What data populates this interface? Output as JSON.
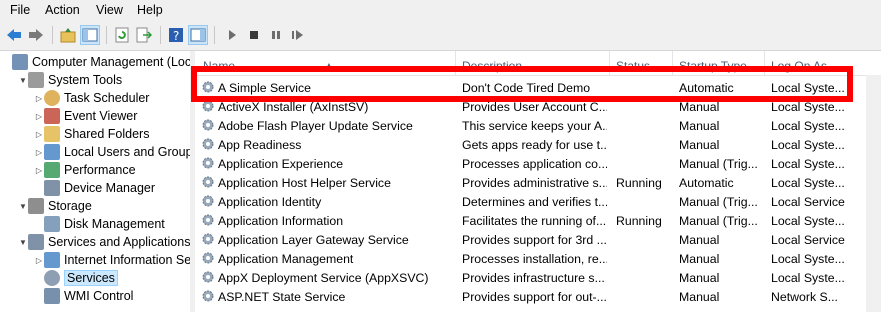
{
  "menu": [
    "File",
    "Action",
    "View",
    "Help"
  ],
  "tree": [
    {
      "label": "Computer Management (Local",
      "indent": 0,
      "arrow": "",
      "icon": "computer-icon"
    },
    {
      "label": "System Tools",
      "indent": 1,
      "arrow": "▼",
      "icon": "tools-icon"
    },
    {
      "label": "Task Scheduler",
      "indent": 2,
      "arrow": "▷",
      "icon": "clock-icon"
    },
    {
      "label": "Event Viewer",
      "indent": 2,
      "arrow": "▷",
      "icon": "event-viewer-icon"
    },
    {
      "label": "Shared Folders",
      "indent": 2,
      "arrow": "▷",
      "icon": "shared-folder-icon"
    },
    {
      "label": "Local Users and Groups",
      "indent": 2,
      "arrow": "▷",
      "icon": "users-icon"
    },
    {
      "label": "Performance",
      "indent": 2,
      "arrow": "▷",
      "icon": "performance-icon"
    },
    {
      "label": "Device Manager",
      "indent": 2,
      "arrow": "",
      "icon": "device-manager-icon"
    },
    {
      "label": "Storage",
      "indent": 1,
      "arrow": "▼",
      "icon": "storage-icon"
    },
    {
      "label": "Disk Management",
      "indent": 2,
      "arrow": "",
      "icon": "disk-icon"
    },
    {
      "label": "Services and Applications",
      "indent": 1,
      "arrow": "▼",
      "icon": "services-apps-icon"
    },
    {
      "label": "Internet Information Ser",
      "indent": 2,
      "arrow": "▷",
      "icon": "iis-icon"
    },
    {
      "label": "Services",
      "indent": 2,
      "arrow": "",
      "icon": "services-icon",
      "selected": true
    },
    {
      "label": "WMI Control",
      "indent": 2,
      "arrow": "",
      "icon": "wmi-icon"
    }
  ],
  "columns": {
    "name": "Name",
    "description": "Description",
    "status": "Status",
    "startup": "Startup Type",
    "logon": "Log On As"
  },
  "rows": [
    {
      "name": "A Simple Service",
      "description": "Don't Code Tired Demo",
      "status": "",
      "startup": "Automatic",
      "logon": "Local Syste..."
    },
    {
      "name": "ActiveX Installer (AxInstSV)",
      "description": "Provides User Account C...",
      "status": "",
      "startup": "Manual",
      "logon": "Local Syste..."
    },
    {
      "name": "Adobe Flash Player Update Service",
      "description": "This service keeps your A...",
      "status": "",
      "startup": "Manual",
      "logon": "Local Syste..."
    },
    {
      "name": "App Readiness",
      "description": "Gets apps ready for use t...",
      "status": "",
      "startup": "Manual",
      "logon": "Local Syste..."
    },
    {
      "name": "Application Experience",
      "description": "Processes application co...",
      "status": "",
      "startup": "Manual (Trig...",
      "logon": "Local Syste..."
    },
    {
      "name": "Application Host Helper Service",
      "description": "Provides administrative s...",
      "status": "Running",
      "startup": "Automatic",
      "logon": "Local Syste..."
    },
    {
      "name": "Application Identity",
      "description": "Determines and verifies t...",
      "status": "",
      "startup": "Manual (Trig...",
      "logon": "Local Service"
    },
    {
      "name": "Application Information",
      "description": "Facilitates the running of...",
      "status": "Running",
      "startup": "Manual (Trig...",
      "logon": "Local Syste..."
    },
    {
      "name": "Application Layer Gateway Service",
      "description": "Provides support for 3rd ...",
      "status": "",
      "startup": "Manual",
      "logon": "Local Service"
    },
    {
      "name": "Application Management",
      "description": "Processes installation, re...",
      "status": "",
      "startup": "Manual",
      "logon": "Local Syste..."
    },
    {
      "name": "AppX Deployment Service (AppXSVC)",
      "description": "Provides infrastructure s...",
      "status": "",
      "startup": "Manual",
      "logon": "Local Syste..."
    },
    {
      "name": "ASP.NET State Service",
      "description": "Provides support for out-...",
      "status": "",
      "startup": "Manual",
      "logon": "Network S..."
    }
  ]
}
